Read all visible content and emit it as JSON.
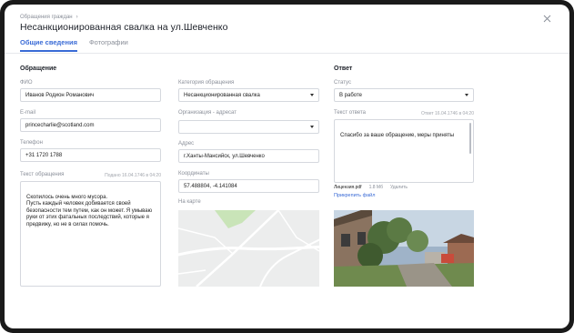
{
  "header": {
    "breadcrumb": "Обращения граждан",
    "title": "Несанкционированная свалка на ул.Шевченко"
  },
  "tabs": [
    {
      "label": "Общие сведения",
      "active": true
    },
    {
      "label": "Фотографии",
      "active": false
    }
  ],
  "request": {
    "section_title": "Обращение",
    "fio_label": "ФИО",
    "fio_value": "Иванов Родион Романович",
    "email_label": "E-mail",
    "email_value": "princecharlie@scotland.com",
    "phone_label": "Телефон",
    "phone_value": "+31 1720 1788",
    "text_label": "Текст обращения",
    "text_meta": "Подано 16.04.1746 в 04:20",
    "text_value": "Скопилось очень много мусора.\nПусть каждый человек добивается своей безопасности тем путем, как он может. Я умываю руки от этих фатальных последствий, которые я предвижу, но не в силах помочь."
  },
  "routing": {
    "category_label": "Категория обращения",
    "category_value": "Несанкционированная свалка",
    "org_label": "Организация - адресат",
    "org_value": "",
    "address_label": "Адрес",
    "address_value": "г.Ханты-Мансийск, ул.Шевченко",
    "coords_label": "Координаты",
    "coords_value": "57.488804, -4.141084",
    "map_label": "На карте"
  },
  "answer": {
    "section_title": "Ответ",
    "status_label": "Статус",
    "status_value": "В работе",
    "text_label": "Текст ответа",
    "text_meta": "Ответ 16.04.1746 в 04:20",
    "text_value": "Спасибо за ваше обращение, меры приняты",
    "file_name": "Лицензия.pdf",
    "file_size": "1.8 Мб",
    "file_delete": "Удалить",
    "attach_label": "Прикрепить файл"
  },
  "colors": {
    "accent": "#3a6bd6",
    "border": "#d5d8de",
    "muted": "#8a8f99"
  }
}
